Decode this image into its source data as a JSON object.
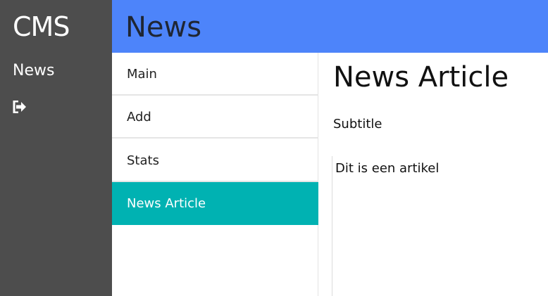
{
  "sidebar": {
    "brand": "CMS",
    "nav_label": "News",
    "logout_icon": "sign-out-icon"
  },
  "header": {
    "title": "News"
  },
  "list": {
    "items": [
      {
        "label": "Main",
        "active": false
      },
      {
        "label": "Add",
        "active": false
      },
      {
        "label": "Stats",
        "active": false
      },
      {
        "label": "News Article",
        "active": true
      }
    ]
  },
  "article": {
    "title": "News Article",
    "subtitle": "Subtitle",
    "body": "Dit is een artikel"
  },
  "colors": {
    "sidebar_bg": "#4d4d4d",
    "header_bg": "#4d84fa",
    "active_item_bg": "#00b2b2"
  }
}
